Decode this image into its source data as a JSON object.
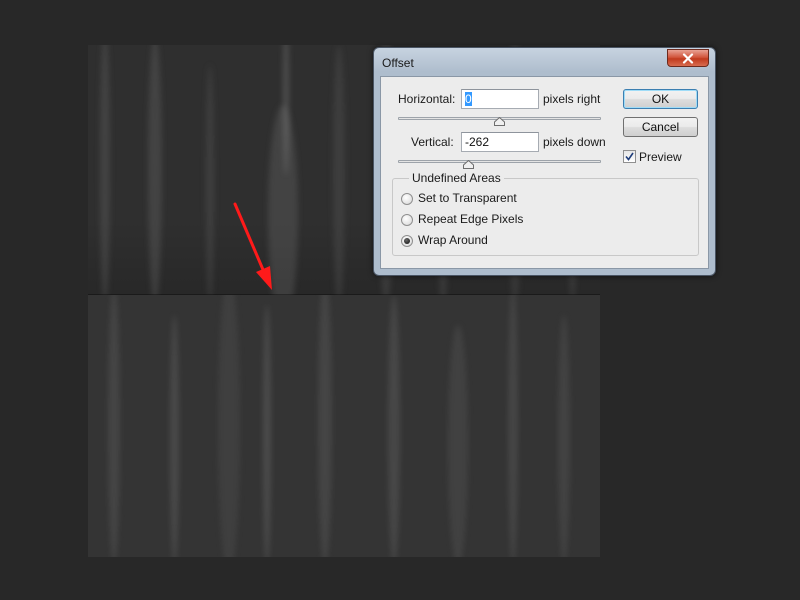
{
  "dialog": {
    "title": "Offset",
    "horizontal": {
      "label": "Horizontal:",
      "value": "0",
      "unit": "pixels right"
    },
    "vertical": {
      "label": "Vertical:",
      "value": "-262",
      "unit": "pixels down"
    },
    "buttons": {
      "ok": "OK",
      "cancel": "Cancel"
    },
    "preview": {
      "label": "Preview",
      "checked": true
    },
    "undefined_areas": {
      "title": "Undefined Areas",
      "options": [
        {
          "label": "Set to Transparent",
          "selected": false
        },
        {
          "label": "Repeat Edge Pixels",
          "selected": false
        },
        {
          "label": "Wrap Around",
          "selected": true
        }
      ]
    }
  },
  "icons": {
    "close": "close-icon",
    "checkmark": "checkmark-icon",
    "annotation": "red-arrow-icon"
  },
  "colors": {
    "annotation_arrow": "#ff1a1a",
    "workspace_background": "#282828",
    "selection_highlight": "#3399ff"
  }
}
